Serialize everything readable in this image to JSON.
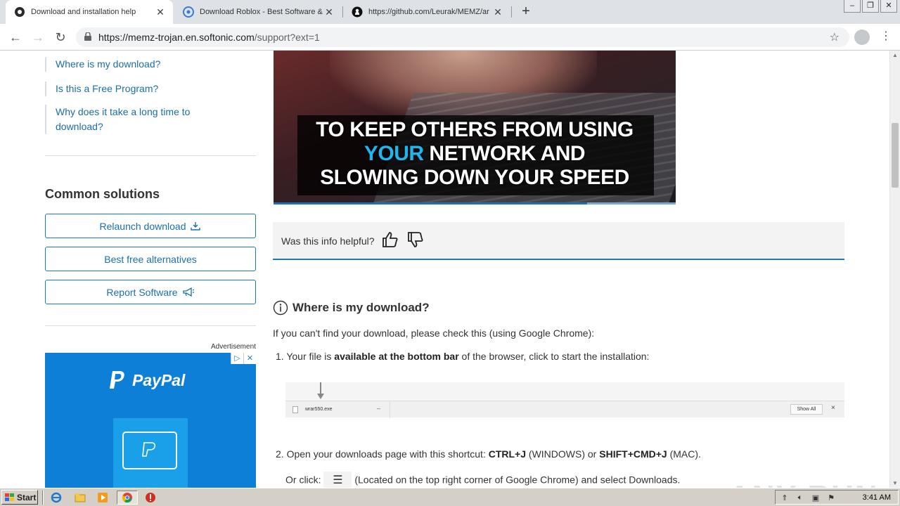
{
  "browser": {
    "tabs": [
      {
        "title": "Download and installation help",
        "favicon": "softonic-icon"
      },
      {
        "title": "Download Roblox - Best Software & ",
        "favicon": "softonic-icon"
      },
      {
        "title": "https://github.com/Leurak/MEMZ/ar",
        "favicon": "github-icon"
      }
    ],
    "new_tab_label": "+",
    "url_host": "https://memz-trojan.en.softonic.com",
    "url_path": "/support?ext=1"
  },
  "sidebar": {
    "links": [
      {
        "line1": "Where is my download?"
      },
      {
        "line1": "Is this a Free Program?"
      },
      {
        "line1": "Why does it take a long time to",
        "line2": "download?"
      }
    ],
    "common_title": "Common solutions",
    "buttons": {
      "relaunch": "Relaunch download",
      "alternatives": "Best free alternatives",
      "report": "Report Software"
    },
    "ad_label": "Advertisement",
    "ad_brand": "PayPal"
  },
  "video": {
    "line1": "TO KEEP OTHERS FROM USING",
    "line2_highlight": "YOUR",
    "line2_rest": " NETWORK AND",
    "line3": "SLOWING DOWN YOUR SPEED",
    "progress": 0.78
  },
  "feedback": {
    "question": "Was this info helpful?"
  },
  "section": {
    "title": "Where is my download?",
    "intro": "If you can't find your download, please check this (using Google Chrome):",
    "step1_prefix": "1. Your file is ",
    "step1_bold": "available at the bottom bar",
    "step1_suffix": " of the browser, click to start the installation:",
    "dlbar": {
      "filename": "wrar550.exe",
      "show_all": "Show All",
      "close": "×"
    },
    "step2_prefix": "2. Open your downloads page with this shortcut: ",
    "step2_key1": "CTRL+J",
    "step2_mid": " (WINDOWS) or ",
    "step2_key2": "SHIFT+CMD+J",
    "step2_suffix": " (MAC).",
    "step3_prefix": "Or click: ",
    "step3_suffix": " (Located on the top right corner of Google Chrome) and select Downloads."
  },
  "watermark": "ANY RUN",
  "taskbar": {
    "start_label": "Start",
    "clock": "3:41 AM"
  },
  "colors": {
    "link": "#1c6ea4",
    "accent": "#1b7ab8",
    "paypal_bg": "#0e7fd6"
  }
}
